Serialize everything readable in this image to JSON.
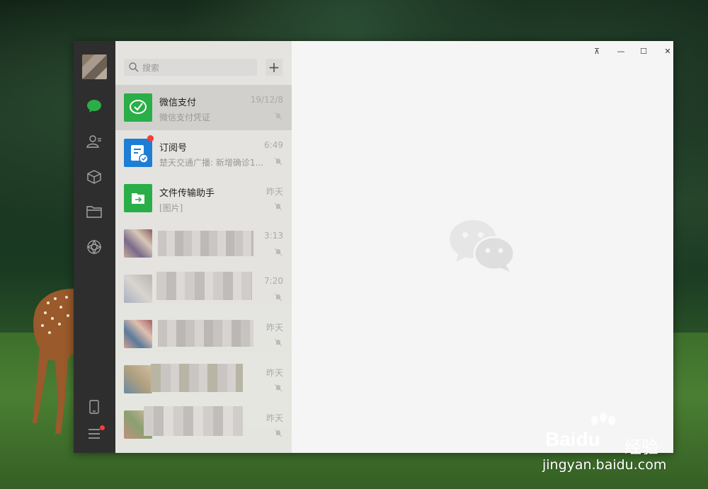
{
  "search": {
    "placeholder": "搜索"
  },
  "add_button": {
    "label": "+",
    "icon": "plus-icon"
  },
  "nav": {
    "items": [
      {
        "icon": "chat-icon",
        "active": true
      },
      {
        "icon": "contacts-icon"
      },
      {
        "icon": "box-icon"
      },
      {
        "icon": "folder-icon"
      },
      {
        "icon": "moments-icon"
      }
    ],
    "bottom": [
      {
        "icon": "phone-icon"
      },
      {
        "icon": "menu-icon",
        "badge": true
      }
    ]
  },
  "chats": [
    {
      "name": "微信支付",
      "preview": "微信支付凭证",
      "time": "19/12/8",
      "muted": true,
      "color": "#2aae47"
    },
    {
      "name": "订阅号",
      "preview": "楚天交通广播: 新增确诊1...",
      "time": "6:49",
      "muted": true,
      "color": "#1e7ed6",
      "badge": true
    },
    {
      "name": "文件传输助手",
      "preview": "[图片]",
      "time": "昨天",
      "muted": true,
      "color": "#2aae47"
    },
    {
      "name": "",
      "preview": "",
      "time": "3:13",
      "muted": true,
      "blurred": true
    },
    {
      "name": "",
      "preview": "",
      "time": "7:20",
      "muted": true,
      "blurred": true
    },
    {
      "name": "",
      "preview": "",
      "time": "昨天",
      "muted": true,
      "blurred": true
    },
    {
      "name": "",
      "preview": "",
      "time": "昨天",
      "muted": true,
      "blurred": true
    },
    {
      "name": "",
      "preview": "",
      "time": "昨天",
      "muted": true,
      "blurred": true
    }
  ],
  "window": {
    "pin": "⊼",
    "minimize": "—",
    "maximize": "☐",
    "close": "✕"
  },
  "watermark": {
    "brand": "Bai",
    "brand2": "du",
    "cn": "经验",
    "url": "jingyan.baidu.com"
  },
  "colors": {
    "wechat_green": "#2aae47",
    "sidebar": "#2e2e2e",
    "accent_blue": "#1e7ed6",
    "badge": "#fa3b3b"
  }
}
